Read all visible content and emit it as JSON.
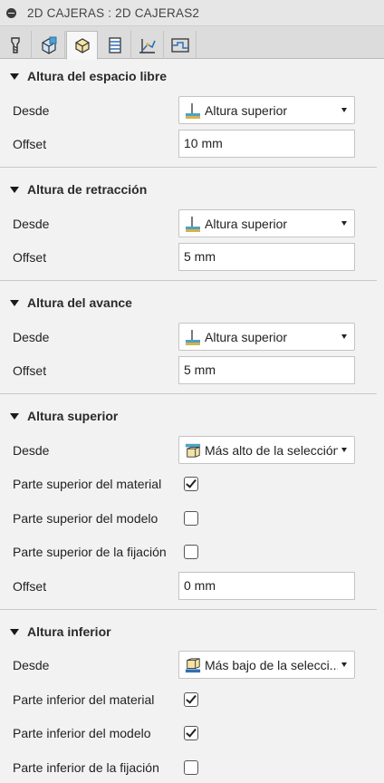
{
  "window": {
    "title": "2D CAJERAS : 2D CAJERAS2"
  },
  "tabs": [
    {
      "icon": "tool-icon",
      "active": false
    },
    {
      "icon": "geometry-icon",
      "active": false
    },
    {
      "icon": "heights-icon",
      "active": true
    },
    {
      "icon": "passes-icon",
      "active": false
    },
    {
      "icon": "linking-icon",
      "active": false
    },
    {
      "icon": "shaft-holder-icon",
      "active": false
    }
  ],
  "sections": {
    "clearance": {
      "title": "Altura del espacio libre",
      "from_label": "Desde",
      "from_value": "Altura superior",
      "offset_label": "Offset",
      "offset_value": "10 mm"
    },
    "retract": {
      "title": "Altura de retracción",
      "from_label": "Desde",
      "from_value": "Altura superior",
      "offset_label": "Offset",
      "offset_value": "5 mm"
    },
    "feed": {
      "title": "Altura del avance",
      "from_label": "Desde",
      "from_value": "Altura superior",
      "offset_label": "Offset",
      "offset_value": "5 mm"
    },
    "top": {
      "title": "Altura superior",
      "from_label": "Desde",
      "from_value": "Más alto de la selección",
      "stock_top_label": "Parte superior del material",
      "stock_top_checked": true,
      "model_top_label": "Parte superior del modelo",
      "model_top_checked": false,
      "fixture_top_label": "Parte superior de la fijación",
      "fixture_top_checked": false,
      "offset_label": "Offset",
      "offset_value": "0 mm"
    },
    "bottom": {
      "title": "Altura inferior",
      "from_label": "Desde",
      "from_value": "Más bajo de la selecci...",
      "stock_bottom_label": "Parte inferior del material",
      "stock_bottom_checked": true,
      "model_bottom_label": "Parte inferior del modelo",
      "model_bottom_checked": true,
      "fixture_bottom_label": "Parte inferior de la fijación",
      "fixture_bottom_checked": false
    }
  },
  "colors": {
    "icon_blue": "#2f6fb5",
    "icon_gold": "#d8b24a",
    "icon_teal": "#4aa3c8"
  }
}
